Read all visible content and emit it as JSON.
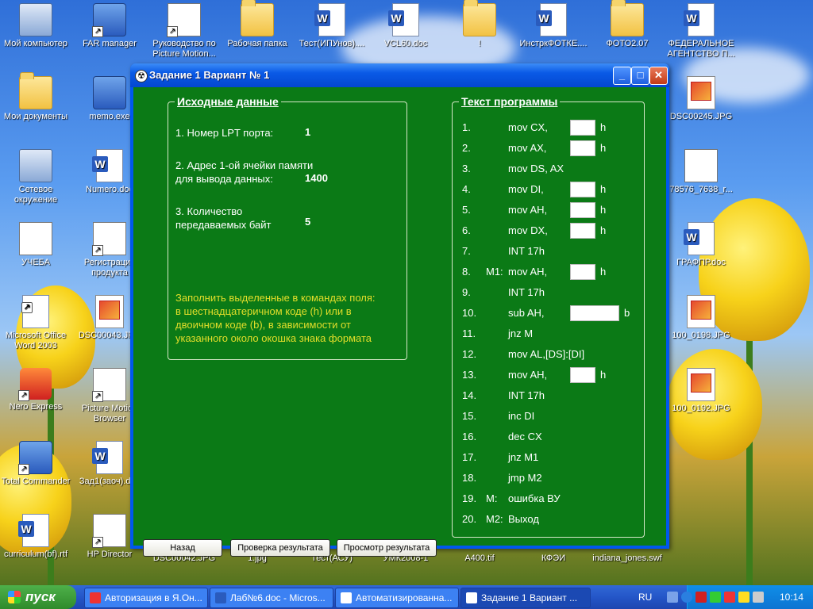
{
  "desktop": {
    "icons": [
      {
        "label": "Мой компьютер"
      },
      {
        "label": "FAR manager"
      },
      {
        "label": "Руководство по Picture Motion..."
      },
      {
        "label": "Рабочая папка"
      },
      {
        "label": "Тест(ИПУнов)...."
      },
      {
        "label": "VCL60.doc"
      },
      {
        "label": "!"
      },
      {
        "label": "ИнстркФОТКЕ...."
      },
      {
        "label": "ФОТО2.07"
      },
      {
        "label": "ФЕДЕРАЛЬНОЕ АГЕНТСТВО П..."
      },
      {
        "label": "Мои документы"
      },
      {
        "label": "memo.exe"
      },
      {
        "label": "DSC00245.JPG"
      },
      {
        "label": "Сетевое окружение"
      },
      {
        "label": "Numero.doc"
      },
      {
        "label": "78576_7638_r..."
      },
      {
        "label": "УЧЕБА"
      },
      {
        "label": "Регистрация продукта"
      },
      {
        "label": "ГРАФПР.doc"
      },
      {
        "label": "Microsoft Office Word 2003"
      },
      {
        "label": "DSC00043.JPG"
      },
      {
        "label": "100_0198.JPG"
      },
      {
        "label": "Nero Express"
      },
      {
        "label": "Picture Motion Browser"
      },
      {
        "label": "100_0192.JPG"
      },
      {
        "label": "Total Commander"
      },
      {
        "label": "Зад1(заоч).doc"
      },
      {
        "label": "curriculum(bf).rtf"
      },
      {
        "label": "HP Director"
      },
      {
        "label": "DSC00042.JPG"
      },
      {
        "label": "1.jpg"
      },
      {
        "label": "Тест(АСУ)"
      },
      {
        "label": "УМК2008-1"
      },
      {
        "label": "A400.tif"
      },
      {
        "label": "КФЭИ"
      },
      {
        "label": "indiana_jones.swf"
      }
    ]
  },
  "window": {
    "title": "Задание 1  Вариант № 1",
    "minimize": "_",
    "maximize": "□",
    "close": "✕",
    "source_group": {
      "title": "Исходные данные",
      "lpt_label": "1. Номер LPT порта:",
      "lpt_value": "1",
      "addr_label_1": "2. Адрес 1-ой ячейки памяти",
      "addr_label_2": "для вывода данных:",
      "addr_value": "1400",
      "count_label_1": "3. Количество",
      "count_label_2": "передаваемых байт",
      "count_value": "5",
      "note_1": "Заполнить выделенные в командах поля:",
      "note_2": "в шестнадцатеричном коде (h) или в",
      "note_3": "двоичном коде (b), в зависимости от",
      "note_4": "указанного около окошка знака формата"
    },
    "program_group": {
      "title": "Текст программы",
      "rows": [
        {
          "num": "1.",
          "label": "",
          "cmd": "mov  CX,",
          "suffix": "h",
          "value": ""
        },
        {
          "num": "2.",
          "label": "",
          "cmd": "mov  AX,",
          "suffix": "h",
          "value": ""
        },
        {
          "num": "3.",
          "label": "",
          "cmd": "mov  DS, AX",
          "suffix": "",
          "value": ""
        },
        {
          "num": "4.",
          "label": "",
          "cmd": "mov  DI,",
          "suffix": "h",
          "value": ""
        },
        {
          "num": "5.",
          "label": "",
          "cmd": "mov  AH,",
          "suffix": "h",
          "value": ""
        },
        {
          "num": "6.",
          "label": "",
          "cmd": "mov  DX,",
          "suffix": "h",
          "value": ""
        },
        {
          "num": "7.",
          "label": "",
          "cmd": "INT 17h",
          "suffix": "",
          "value": ""
        },
        {
          "num": "8.",
          "label": "M1:",
          "cmd": "mov  AH,",
          "suffix": "h",
          "value": ""
        },
        {
          "num": "9.",
          "label": "",
          "cmd": "INT 17h",
          "suffix": "",
          "value": ""
        },
        {
          "num": "10.",
          "label": "",
          "cmd": "sub  AH,",
          "suffix": "b",
          "value": ""
        },
        {
          "num": "11.",
          "label": "",
          "cmd": "jnz M",
          "suffix": "",
          "value": ""
        },
        {
          "num": "12.",
          "label": "",
          "cmd": "mov  AL,[DS]:[DI]",
          "suffix": "",
          "value": ""
        },
        {
          "num": "13.",
          "label": "",
          "cmd": "mov  AH,",
          "suffix": "h",
          "value": ""
        },
        {
          "num": "14.",
          "label": "",
          "cmd": "INT 17h",
          "suffix": "",
          "value": ""
        },
        {
          "num": "15.",
          "label": "",
          "cmd": "inc DI",
          "suffix": "",
          "value": ""
        },
        {
          "num": "16.",
          "label": "",
          "cmd": "dec CX",
          "suffix": "",
          "value": ""
        },
        {
          "num": "17.",
          "label": "",
          "cmd": "jnz M1",
          "suffix": "",
          "value": ""
        },
        {
          "num": "18.",
          "label": "",
          "cmd": "jmp M2",
          "suffix": "",
          "value": ""
        },
        {
          "num": "19.",
          "label": "M:",
          "cmd": "ошибка ВУ",
          "suffix": "",
          "value": ""
        },
        {
          "num": "20.",
          "label": "M2:",
          "cmd": "Выход",
          "suffix": "",
          "value": ""
        }
      ]
    },
    "buttons": {
      "back": "Назад",
      "check": "Проверка результата",
      "view": "Просмотр результата"
    }
  },
  "taskbar": {
    "start": "пуск",
    "tasks": [
      {
        "label": "Авторизация в Я.Он..."
      },
      {
        "label": "Лаб№6.doc - Micros..."
      },
      {
        "label": "Автоматизированна..."
      },
      {
        "label": "Задание 1  Вариант ..."
      }
    ],
    "lang": "RU",
    "clock": "10:14"
  },
  "colors": {
    "client_bg": "#0b7a16",
    "note_text": "#e3de2a",
    "titlebar": "#0a5ae6"
  }
}
